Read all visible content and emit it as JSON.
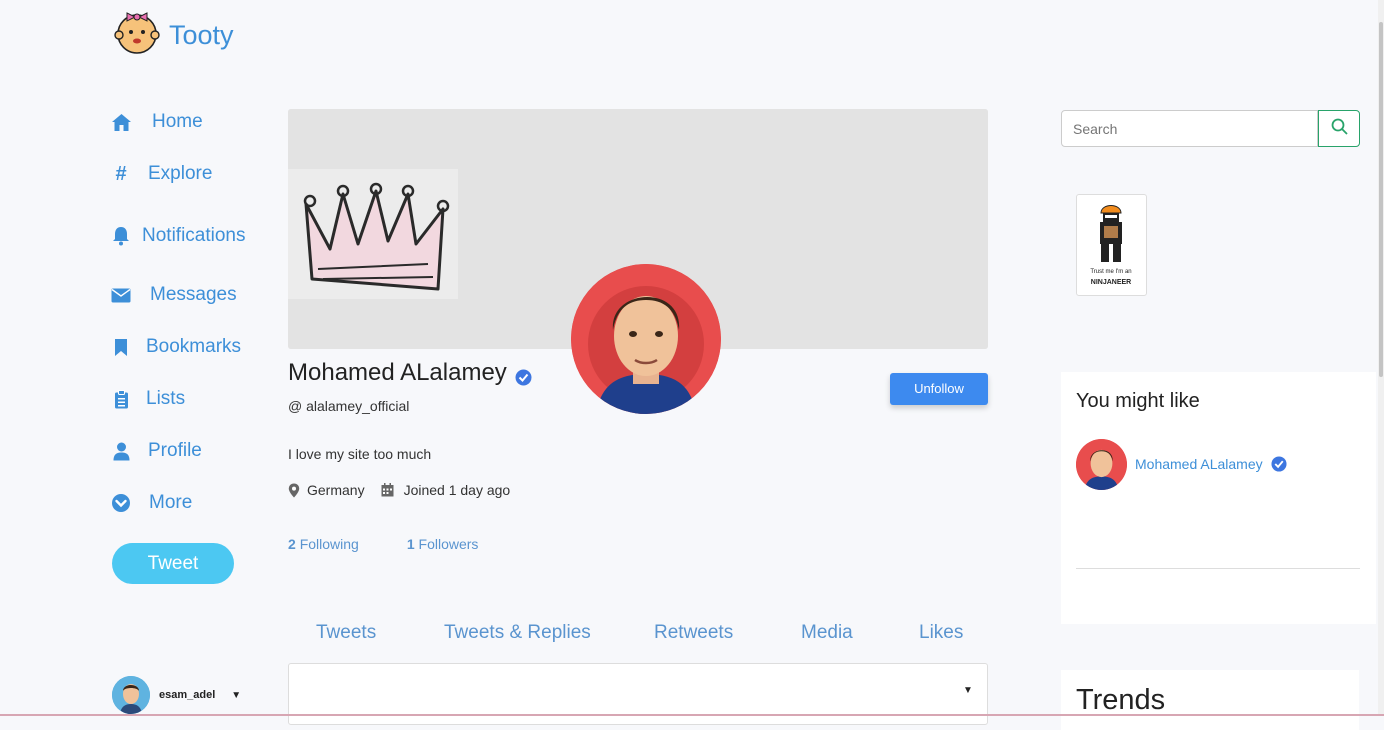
{
  "app": {
    "name": "Tooty"
  },
  "nav": {
    "items": [
      {
        "label": "Home",
        "icon": "home-icon"
      },
      {
        "label": "Explore",
        "icon": "hash-icon"
      },
      {
        "label": "Notifications",
        "icon": "bell-icon"
      },
      {
        "label": "Messages",
        "icon": "envelope-icon"
      },
      {
        "label": "Bookmarks",
        "icon": "bookmark-icon"
      },
      {
        "label": "Lists",
        "icon": "clipboard-icon"
      },
      {
        "label": "Profile",
        "icon": "user-icon"
      },
      {
        "label": "More",
        "icon": "chevron-circle-icon"
      }
    ],
    "tweet_label": "Tweet"
  },
  "account": {
    "username": "esam_adel"
  },
  "profile": {
    "name": "Mohamed ALalamey",
    "handle": "@ alalamey_official",
    "bio": "I love my site too much",
    "location": "Germany",
    "joined": "Joined 1 day ago",
    "following_count": "2",
    "following_label": "Following",
    "followers_count": "1",
    "followers_label": "Followers",
    "unfollow_label": "Unfollow"
  },
  "tabs": [
    "Tweets",
    "Tweets & Replies",
    "Retweets",
    "Media",
    "Likes"
  ],
  "search": {
    "placeholder": "Search"
  },
  "suggestions": {
    "title": "You might like",
    "items": [
      {
        "name": "Mohamed ALalamey"
      }
    ]
  },
  "promo_image": {
    "caption_line1": "Trust me I'm an",
    "caption_line2": "NINJANEER"
  },
  "trends": {
    "title": "Trends"
  },
  "colors": {
    "accent": "#3d8fd8",
    "tweet_button": "#4cc8f2",
    "unfollow_button": "#3d8aef",
    "avatar_bg": "#e84d4d",
    "search_border": "#28a36a"
  }
}
